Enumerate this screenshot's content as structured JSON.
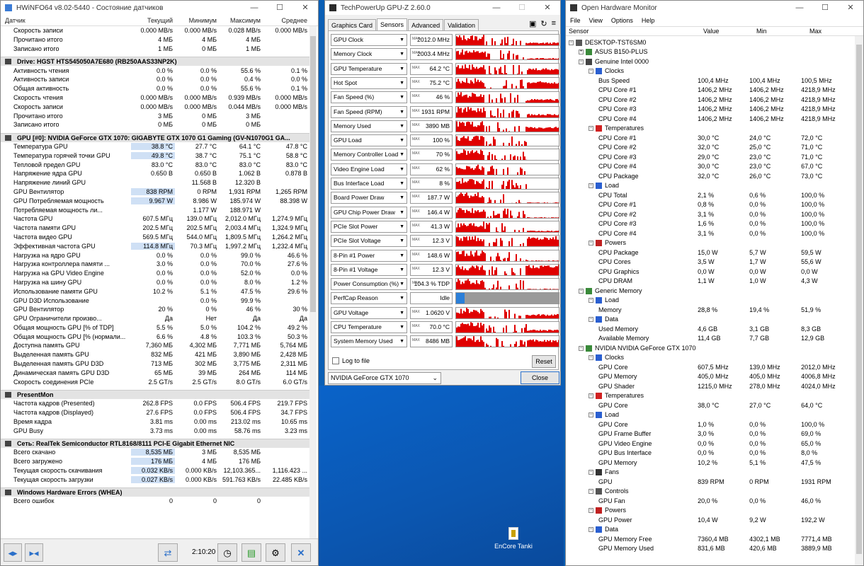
{
  "hwinfo": {
    "title": "HWiNFO64 v8.02-5440 - Состояние датчиков",
    "columns": [
      "Датчик",
      "Текущий",
      "Минимум",
      "Максимум",
      "Среднее"
    ],
    "sections": [
      {
        "title": "",
        "rows": [
          [
            "Скорость записи",
            "0.000 MB/s",
            "0.000 MB/s",
            "0.028 MB/s",
            "0.000 MB/s"
          ],
          [
            "Прочитано итого",
            "4 МБ",
            "4 МБ",
            "4 МБ",
            ""
          ],
          [
            "Записано итого",
            "1 МБ",
            "0 МБ",
            "1 МБ",
            ""
          ]
        ]
      },
      {
        "title": "Drive: HGST HTS545050A7E680 (RB250AAS33NP2K)",
        "rows": [
          [
            "Активность чтения",
            "0.0 %",
            "0.0 %",
            "55.6 %",
            "0.1 %"
          ],
          [
            "Активность записи",
            "0.0 %",
            "0.0 %",
            "0.4 %",
            "0.0 %"
          ],
          [
            "Общая активность",
            "0.0 %",
            "0.0 %",
            "55.6 %",
            "0.1 %"
          ],
          [
            "Скорость чтения",
            "0.000 MB/s",
            "0.000 MB/s",
            "0.939 MB/s",
            "0.000 MB/s"
          ],
          [
            "Скорость записи",
            "0.000 MB/s",
            "0.000 MB/s",
            "0.044 MB/s",
            "0.000 MB/s"
          ],
          [
            "Прочитано итого",
            "3 МБ",
            "0 МБ",
            "3 МБ",
            ""
          ],
          [
            "Записано итого",
            "0 МБ",
            "0 МБ",
            "0 МБ",
            ""
          ]
        ]
      },
      {
        "title": "GPU [#0]: NVIDIA GeForce GTX 1070: GIGABYTE GTX 1070 G1 Gaming (GV-N1070G1 GA...",
        "rows": [
          [
            "Температура GPU",
            "38.8 °C",
            "27.7 °C",
            "64.1 °C",
            "47.8 °C"
          ],
          [
            "Температура горячей точки GPU",
            "49.8 °C",
            "38.7 °C",
            "75.1 °C",
            "58.8 °C"
          ],
          [
            "Тепловой предел GPU",
            "83.0 °C",
            "83.0 °C",
            "83.0 °C",
            "83.0 °C"
          ],
          [
            "Напряжение ядра GPU",
            "0.650 В",
            "0.650 В",
            "1.062 В",
            "0.878 В"
          ],
          [
            "Напряжение линий GPU",
            "",
            "11.568 В",
            "12.320 В",
            ""
          ],
          [
            "GPU Вентилятор",
            "838 RPM",
            "0 RPM",
            "1,931 RPM",
            "1,265 RPM"
          ],
          [
            "GPU Потребляемая мощность",
            "9.967 W",
            "8.986 W",
            "185.974 W",
            "88.398 W"
          ],
          [
            "Потребляемая мощность ли...",
            "",
            "1.177 W",
            "188.971 W",
            ""
          ],
          [
            "Частота GPU",
            "607.5 МГц",
            "139.0 МГц",
            "2,012.0 МГц",
            "1,274.9 МГц"
          ],
          [
            "Частота памяти GPU",
            "202.5 МГц",
            "202.5 МГц",
            "2,003.4 МГц",
            "1,324.9 МГц"
          ],
          [
            "Частота видео GPU",
            "569.5 МГц",
            "544.0 МГц",
            "1,809.5 МГц",
            "1,264.2 МГц"
          ],
          [
            "Эффективная частота GPU",
            "114.8 МГц",
            "70.3 МГц",
            "1,997.2 МГц",
            "1,232.4 МГц"
          ],
          [
            "Нагрузка на ядро GPU",
            "0.0 %",
            "0.0 %",
            "99.0 %",
            "46.6 %"
          ],
          [
            "Нагрузка контроллера памяти ...",
            "3.0 %",
            "0.0 %",
            "70.0 %",
            "27.6 %"
          ],
          [
            "Нагрузка на GPU Video Engine",
            "0.0 %",
            "0.0 %",
            "52.0 %",
            "0.0 %"
          ],
          [
            "Нагрузка на шину GPU",
            "0.0 %",
            "0.0 %",
            "8.0 %",
            "1.2 %"
          ],
          [
            "Использование памяти GPU",
            "10.2 %",
            "5.1 %",
            "47.5 %",
            "29.6 %"
          ],
          [
            "GPU D3D Использование",
            "",
            "0.0 %",
            "99.9 %",
            ""
          ],
          [
            "GPU Вентилятор",
            "20 %",
            "0 %",
            "46 %",
            "30 %"
          ],
          [
            "GPU Ограничители произво...",
            "Да",
            "Нет",
            "Да",
            "Да"
          ],
          [
            "Общая мощность GPU [% of TDP]",
            "5.5 %",
            "5.0 %",
            "104.2 %",
            "49.2 %"
          ],
          [
            "Общая мощность GPU [% (нормали...",
            "6.6 %",
            "4.8 %",
            "103.3 %",
            "50.3 %"
          ],
          [
            "Доступна память GPU",
            "7,360 МБ",
            "4,302 МБ",
            "7,771 МБ",
            "5,764 МБ"
          ],
          [
            "Выделенная память GPU",
            "832 МБ",
            "421 МБ",
            "3,890 МБ",
            "2,428 МБ"
          ],
          [
            "Выделенная память GPU D3D",
            "713 МБ",
            "302 МБ",
            "3,775 МБ",
            "2,311 МБ"
          ],
          [
            "Динамическая память GPU D3D",
            "65 МБ",
            "39 МБ",
            "264 МБ",
            "114 МБ"
          ],
          [
            "Скорость соединения PCIe",
            "2.5 GT/s",
            "2.5 GT/s",
            "8.0 GT/s",
            "6.0 GT/s"
          ]
        ]
      },
      {
        "title": "PresentMon",
        "rows": [
          [
            "Частота кадров (Presented)",
            "262.8 FPS",
            "0.0 FPS",
            "506.4 FPS",
            "219.7 FPS"
          ],
          [
            "Частота кадров (Displayed)",
            "27.6 FPS",
            "0.0 FPS",
            "506.4 FPS",
            "34.7 FPS"
          ],
          [
            "Время кадра",
            "3.81 ms",
            "0.00 ms",
            "213.02 ms",
            "10.65 ms"
          ],
          [
            "GPU Busy",
            "3.73 ms",
            "0.00 ms",
            "58.76 ms",
            "3.23 ms"
          ]
        ]
      },
      {
        "title": "Сеть: RealTek Semiconductor RTL8168/8111 PCI-E Gigabit Ethernet NIC",
        "rows": [
          [
            "Всего скачано",
            "8,535 МБ",
            "3 МБ",
            "8,535 МБ",
            ""
          ],
          [
            "Всего загружено",
            "176 МБ",
            "4 МБ",
            "176 МБ",
            ""
          ],
          [
            "Текущая скорость скачивания",
            "0.032 KB/s",
            "0.000 KB/s",
            "12,103.365...",
            "1,116.423 ..."
          ],
          [
            "Текущая скорость загрузки",
            "0.027 KB/s",
            "0.000 KB/s",
            "591.763 KB/s",
            "22.485 KB/s"
          ]
        ]
      },
      {
        "title": "Windows Hardware Errors (WHEA)",
        "rows": [
          [
            "Всего ошибок",
            "0",
            "0",
            "0",
            ""
          ]
        ]
      }
    ],
    "footer_time": "2:10:20"
  },
  "gpuz": {
    "title": "TechPowerUp GPU-Z 2.60.0",
    "tabs": [
      "Graphics Card",
      "Sensors",
      "Advanced",
      "Validation"
    ],
    "sensors": [
      {
        "name": "GPU Clock",
        "value": "2012.0 MHz",
        "max": true,
        "level": 0.3
      },
      {
        "name": "Memory Clock",
        "value": "2003.4 MHz",
        "max": true,
        "level": 0.2
      },
      {
        "name": "GPU Temperature",
        "value": "64.2 °C",
        "max": true,
        "level": 0.55
      },
      {
        "name": "Hot Spot",
        "value": "75.2 °C",
        "max": true,
        "level": 0.6
      },
      {
        "name": "Fan Speed (%)",
        "value": "46 %",
        "max": true,
        "level": 0.35
      },
      {
        "name": "Fan Speed (RPM)",
        "value": "1931 RPM",
        "max": true,
        "level": 0.35
      },
      {
        "name": "Memory Used",
        "value": "3890 MB",
        "max": true,
        "level": 0.45
      },
      {
        "name": "GPU Load",
        "value": "100 %",
        "max": true,
        "level": 0.1
      },
      {
        "name": "Memory Controller Load",
        "value": "70 %",
        "max": true,
        "level": 0.1
      },
      {
        "name": "Video Engine Load",
        "value": "62 %",
        "max": true,
        "level": 0.05
      },
      {
        "name": "Bus Interface Load",
        "value": "8 %",
        "max": true,
        "level": 0.0
      },
      {
        "name": "Board Power Draw",
        "value": "187.7 W",
        "max": true,
        "level": 0.15
      },
      {
        "name": "GPU Chip Power Draw",
        "value": "146.4 W",
        "max": true,
        "level": 0.15
      },
      {
        "name": "PCIe Slot Power",
        "value": "41.3 W",
        "max": true,
        "level": 0.2
      },
      {
        "name": "PCIe Slot Voltage",
        "value": "12.3 V",
        "max": true,
        "level": 0.8
      },
      {
        "name": "8-Pin #1 Power",
        "value": "148.6 W",
        "max": true,
        "level": 0.15
      },
      {
        "name": "8-Pin #1 Voltage",
        "value": "12.3 V",
        "max": true,
        "level": 0.85
      },
      {
        "name": "Power Consumption (%)",
        "value": "104.3 % TDP",
        "max": true,
        "level": 0.15
      },
      {
        "name": "PerfCap Reason",
        "value": "Idle",
        "max": false,
        "level": 0.0
      },
      {
        "name": "GPU Voltage",
        "value": "1.0620 V",
        "max": true,
        "level": 0.4
      },
      {
        "name": "CPU Temperature",
        "value": "70.0 °C",
        "max": true,
        "level": 0.3
      },
      {
        "name": "System Memory Used",
        "value": "8486 MB",
        "max": true,
        "level": 0.6
      }
    ],
    "max_tag": "MAX",
    "log_label": "Log to file",
    "reset_label": "Reset",
    "device": "NVIDIA GeForce GTX 1070",
    "close_label": "Close"
  },
  "ohm": {
    "title": "Open Hardware Monitor",
    "menu": [
      "File",
      "View",
      "Options",
      "Help"
    ],
    "columns": [
      "Sensor",
      "Value",
      "Min",
      "Max"
    ],
    "rows": [
      {
        "lvl": 0,
        "kind": "pc",
        "name": "DESKTOP-TST6SM0",
        "v": "",
        "mn": "",
        "mx": ""
      },
      {
        "lvl": 1,
        "kind": "board",
        "name": "ASUS B150-PLUS",
        "v": "",
        "mn": "",
        "mx": ""
      },
      {
        "lvl": 1,
        "kind": "cpu",
        "name": "Genuine Intel 0000",
        "v": "",
        "mn": "",
        "mx": ""
      },
      {
        "lvl": 2,
        "kind": "clock",
        "name": "Clocks",
        "v": "",
        "mn": "",
        "mx": ""
      },
      {
        "lvl": 3,
        "kind": "",
        "name": "Bus Speed",
        "v": "100,4 MHz",
        "mn": "100,4 MHz",
        "mx": "100,5 MHz"
      },
      {
        "lvl": 3,
        "kind": "",
        "name": "CPU Core #1",
        "v": "1406,2 MHz",
        "mn": "1406,2 MHz",
        "mx": "4218,9 MHz"
      },
      {
        "lvl": 3,
        "kind": "",
        "name": "CPU Core #2",
        "v": "1406,2 MHz",
        "mn": "1406,2 MHz",
        "mx": "4218,9 MHz"
      },
      {
        "lvl": 3,
        "kind": "",
        "name": "CPU Core #3",
        "v": "1406,2 MHz",
        "mn": "1406,2 MHz",
        "mx": "4218,9 MHz"
      },
      {
        "lvl": 3,
        "kind": "",
        "name": "CPU Core #4",
        "v": "1406,2 MHz",
        "mn": "1406,2 MHz",
        "mx": "4218,9 MHz"
      },
      {
        "lvl": 2,
        "kind": "temp",
        "name": "Temperatures",
        "v": "",
        "mn": "",
        "mx": ""
      },
      {
        "lvl": 3,
        "kind": "",
        "name": "CPU Core #1",
        "v": "30,0 °C",
        "mn": "24,0 °C",
        "mx": "72,0 °C"
      },
      {
        "lvl": 3,
        "kind": "",
        "name": "CPU Core #2",
        "v": "32,0 °C",
        "mn": "25,0 °C",
        "mx": "71,0 °C"
      },
      {
        "lvl": 3,
        "kind": "",
        "name": "CPU Core #3",
        "v": "29,0 °C",
        "mn": "23,0 °C",
        "mx": "71,0 °C"
      },
      {
        "lvl": 3,
        "kind": "",
        "name": "CPU Core #4",
        "v": "30,0 °C",
        "mn": "23,0 °C",
        "mx": "67,0 °C"
      },
      {
        "lvl": 3,
        "kind": "",
        "name": "CPU Package",
        "v": "32,0 °C",
        "mn": "26,0 °C",
        "mx": "73,0 °C"
      },
      {
        "lvl": 2,
        "kind": "load",
        "name": "Load",
        "v": "",
        "mn": "",
        "mx": ""
      },
      {
        "lvl": 3,
        "kind": "",
        "name": "CPU Total",
        "v": "2,1 %",
        "mn": "0,6 %",
        "mx": "100,0 %"
      },
      {
        "lvl": 3,
        "kind": "",
        "name": "CPU Core #1",
        "v": "0,8 %",
        "mn": "0,0 %",
        "mx": "100,0 %"
      },
      {
        "lvl": 3,
        "kind": "",
        "name": "CPU Core #2",
        "v": "3,1 %",
        "mn": "0,0 %",
        "mx": "100,0 %"
      },
      {
        "lvl": 3,
        "kind": "",
        "name": "CPU Core #3",
        "v": "1,6 %",
        "mn": "0,0 %",
        "mx": "100,0 %"
      },
      {
        "lvl": 3,
        "kind": "",
        "name": "CPU Core #4",
        "v": "3,1 %",
        "mn": "0,0 %",
        "mx": "100,0 %"
      },
      {
        "lvl": 2,
        "kind": "power",
        "name": "Powers",
        "v": "",
        "mn": "",
        "mx": ""
      },
      {
        "lvl": 3,
        "kind": "",
        "name": "CPU Package",
        "v": "15,0 W",
        "mn": "5,7 W",
        "mx": "59,5 W"
      },
      {
        "lvl": 3,
        "kind": "",
        "name": "CPU Cores",
        "v": "3,5 W",
        "mn": "1,7 W",
        "mx": "55,6 W"
      },
      {
        "lvl": 3,
        "kind": "",
        "name": "CPU Graphics",
        "v": "0,0 W",
        "mn": "0,0 W",
        "mx": "0,0 W"
      },
      {
        "lvl": 3,
        "kind": "",
        "name": "CPU DRAM",
        "v": "1,1 W",
        "mn": "1,0 W",
        "mx": "4,3 W"
      },
      {
        "lvl": 1,
        "kind": "ram",
        "name": "Generic Memory",
        "v": "",
        "mn": "",
        "mx": ""
      },
      {
        "lvl": 2,
        "kind": "load",
        "name": "Load",
        "v": "",
        "mn": "",
        "mx": ""
      },
      {
        "lvl": 3,
        "kind": "",
        "name": "Memory",
        "v": "28,8 %",
        "mn": "19,4 %",
        "mx": "51,9 %"
      },
      {
        "lvl": 2,
        "kind": "data",
        "name": "Data",
        "v": "",
        "mn": "",
        "mx": ""
      },
      {
        "lvl": 3,
        "kind": "",
        "name": "Used Memory",
        "v": "4,6 GB",
        "mn": "3,1 GB",
        "mx": "8,3 GB"
      },
      {
        "lvl": 3,
        "kind": "",
        "name": "Available Memory",
        "v": "11,4 GB",
        "mn": "7,7 GB",
        "mx": "12,9 GB"
      },
      {
        "lvl": 1,
        "kind": "gpu",
        "name": "NVIDIA NVIDIA GeForce GTX 1070",
        "v": "",
        "mn": "",
        "mx": ""
      },
      {
        "lvl": 2,
        "kind": "clock",
        "name": "Clocks",
        "v": "",
        "mn": "",
        "mx": ""
      },
      {
        "lvl": 3,
        "kind": "",
        "name": "GPU Core",
        "v": "607,5 MHz",
        "mn": "139,0 MHz",
        "mx": "2012,0 MHz"
      },
      {
        "lvl": 3,
        "kind": "",
        "name": "GPU Memory",
        "v": "405,0 MHz",
        "mn": "405,0 MHz",
        "mx": "4006,8 MHz"
      },
      {
        "lvl": 3,
        "kind": "",
        "name": "GPU Shader",
        "v": "1215,0 MHz",
        "mn": "278,0 MHz",
        "mx": "4024,0 MHz"
      },
      {
        "lvl": 2,
        "kind": "temp",
        "name": "Temperatures",
        "v": "",
        "mn": "",
        "mx": ""
      },
      {
        "lvl": 3,
        "kind": "",
        "name": "GPU Core",
        "v": "38,0 °C",
        "mn": "27,0 °C",
        "mx": "64,0 °C"
      },
      {
        "lvl": 2,
        "kind": "load",
        "name": "Load",
        "v": "",
        "mn": "",
        "mx": ""
      },
      {
        "lvl": 3,
        "kind": "",
        "name": "GPU Core",
        "v": "1,0 %",
        "mn": "0,0 %",
        "mx": "100,0 %"
      },
      {
        "lvl": 3,
        "kind": "",
        "name": "GPU Frame Buffer",
        "v": "3,0 %",
        "mn": "0,0 %",
        "mx": "69,0 %"
      },
      {
        "lvl": 3,
        "kind": "",
        "name": "GPU Video Engine",
        "v": "0,0 %",
        "mn": "0,0 %",
        "mx": "65,0 %"
      },
      {
        "lvl": 3,
        "kind": "",
        "name": "GPU Bus Interface",
        "v": "0,0 %",
        "mn": "0,0 %",
        "mx": "8,0 %"
      },
      {
        "lvl": 3,
        "kind": "",
        "name": "GPU Memory",
        "v": "10,2 %",
        "mn": "5,1 %",
        "mx": "47,5 %"
      },
      {
        "lvl": 2,
        "kind": "fan",
        "name": "Fans",
        "v": "",
        "mn": "",
        "mx": ""
      },
      {
        "lvl": 3,
        "kind": "",
        "name": "GPU",
        "v": "839 RPM",
        "mn": "0 RPM",
        "mx": "1931 RPM"
      },
      {
        "lvl": 2,
        "kind": "ctrl",
        "name": "Controls",
        "v": "",
        "mn": "",
        "mx": ""
      },
      {
        "lvl": 3,
        "kind": "",
        "name": "GPU Fan",
        "v": "20,0 %",
        "mn": "0,0 %",
        "mx": "46,0 %"
      },
      {
        "lvl": 2,
        "kind": "power",
        "name": "Powers",
        "v": "",
        "mn": "",
        "mx": ""
      },
      {
        "lvl": 3,
        "kind": "",
        "name": "GPU Power",
        "v": "10,4 W",
        "mn": "9,2 W",
        "mx": "192,2 W"
      },
      {
        "lvl": 2,
        "kind": "data",
        "name": "Data",
        "v": "",
        "mn": "",
        "mx": ""
      },
      {
        "lvl": 3,
        "kind": "",
        "name": "GPU Memory Free",
        "v": "7360,4 MB",
        "mn": "4302,1 MB",
        "mx": "7771,4 MB"
      },
      {
        "lvl": 3,
        "kind": "",
        "name": "GPU Memory Used",
        "v": "831,6 MB",
        "mn": "420,6 MB",
        "mx": "3889,9 MB"
      }
    ]
  },
  "desktop": {
    "icon_label": "EnCore Tanki"
  },
  "colors": {
    "graph": "#e00000",
    "desktop": "#0b5fb5",
    "highlight": "#cfe0f5"
  }
}
